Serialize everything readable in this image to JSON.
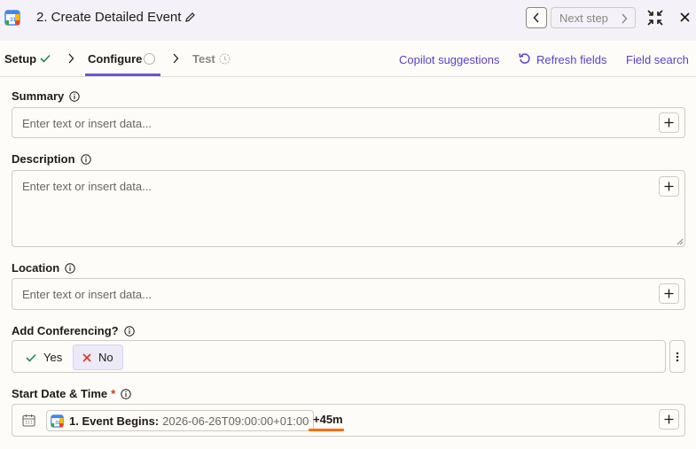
{
  "header": {
    "title": "2. Create Detailed Event",
    "next_step_label": "Next step"
  },
  "tabs": [
    {
      "label": "Setup",
      "state": "complete"
    },
    {
      "label": "Configure",
      "state": "active"
    },
    {
      "label": "Test",
      "state": "pending"
    }
  ],
  "actions": {
    "copilot": "Copilot suggestions",
    "refresh": "Refresh fields",
    "field_search": "Field search"
  },
  "fields": {
    "summary": {
      "label": "Summary",
      "placeholder": "Enter text or insert data..."
    },
    "description": {
      "label": "Description",
      "placeholder": "Enter text or insert data..."
    },
    "location": {
      "label": "Location",
      "placeholder": "Enter text or insert data..."
    },
    "conferencing": {
      "label": "Add Conferencing?",
      "options": [
        {
          "label": "Yes"
        },
        {
          "label": "No"
        }
      ],
      "selected": "No"
    },
    "start": {
      "label": "Start Date & Time",
      "required_mark": "*",
      "pill_label": "1. Event Begins:",
      "pill_value": "2026-06-26T09:00:00+01:00",
      "offset": "+45m"
    }
  },
  "colors": {
    "accent": "#6e56cf",
    "link": "#5b3fd0",
    "highlight": "#ff6a00",
    "required": "#d0391e",
    "success": "#1f8a4c"
  }
}
